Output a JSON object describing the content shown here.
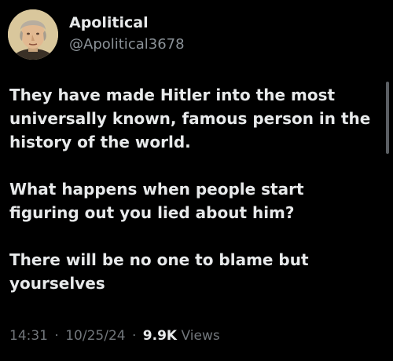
{
  "author": {
    "display_name": "Apolitical",
    "handle": "@Apolitical3678",
    "avatar_icon": "portrait-avatar"
  },
  "tweet": {
    "paragraphs": [
      "They have made Hitler into the most universally known, famous person in the history of the world.",
      "What happens when people start figuring out you lied about him?",
      "There will be no one to blame but yourselves"
    ],
    "time": "14:31",
    "date": "10/25/24",
    "separator": "·",
    "views_count": "9.9K",
    "views_label": "Views"
  },
  "colors": {
    "background": "#000000",
    "primary_text": "#e7e9ea",
    "secondary_text": "#71767b"
  }
}
